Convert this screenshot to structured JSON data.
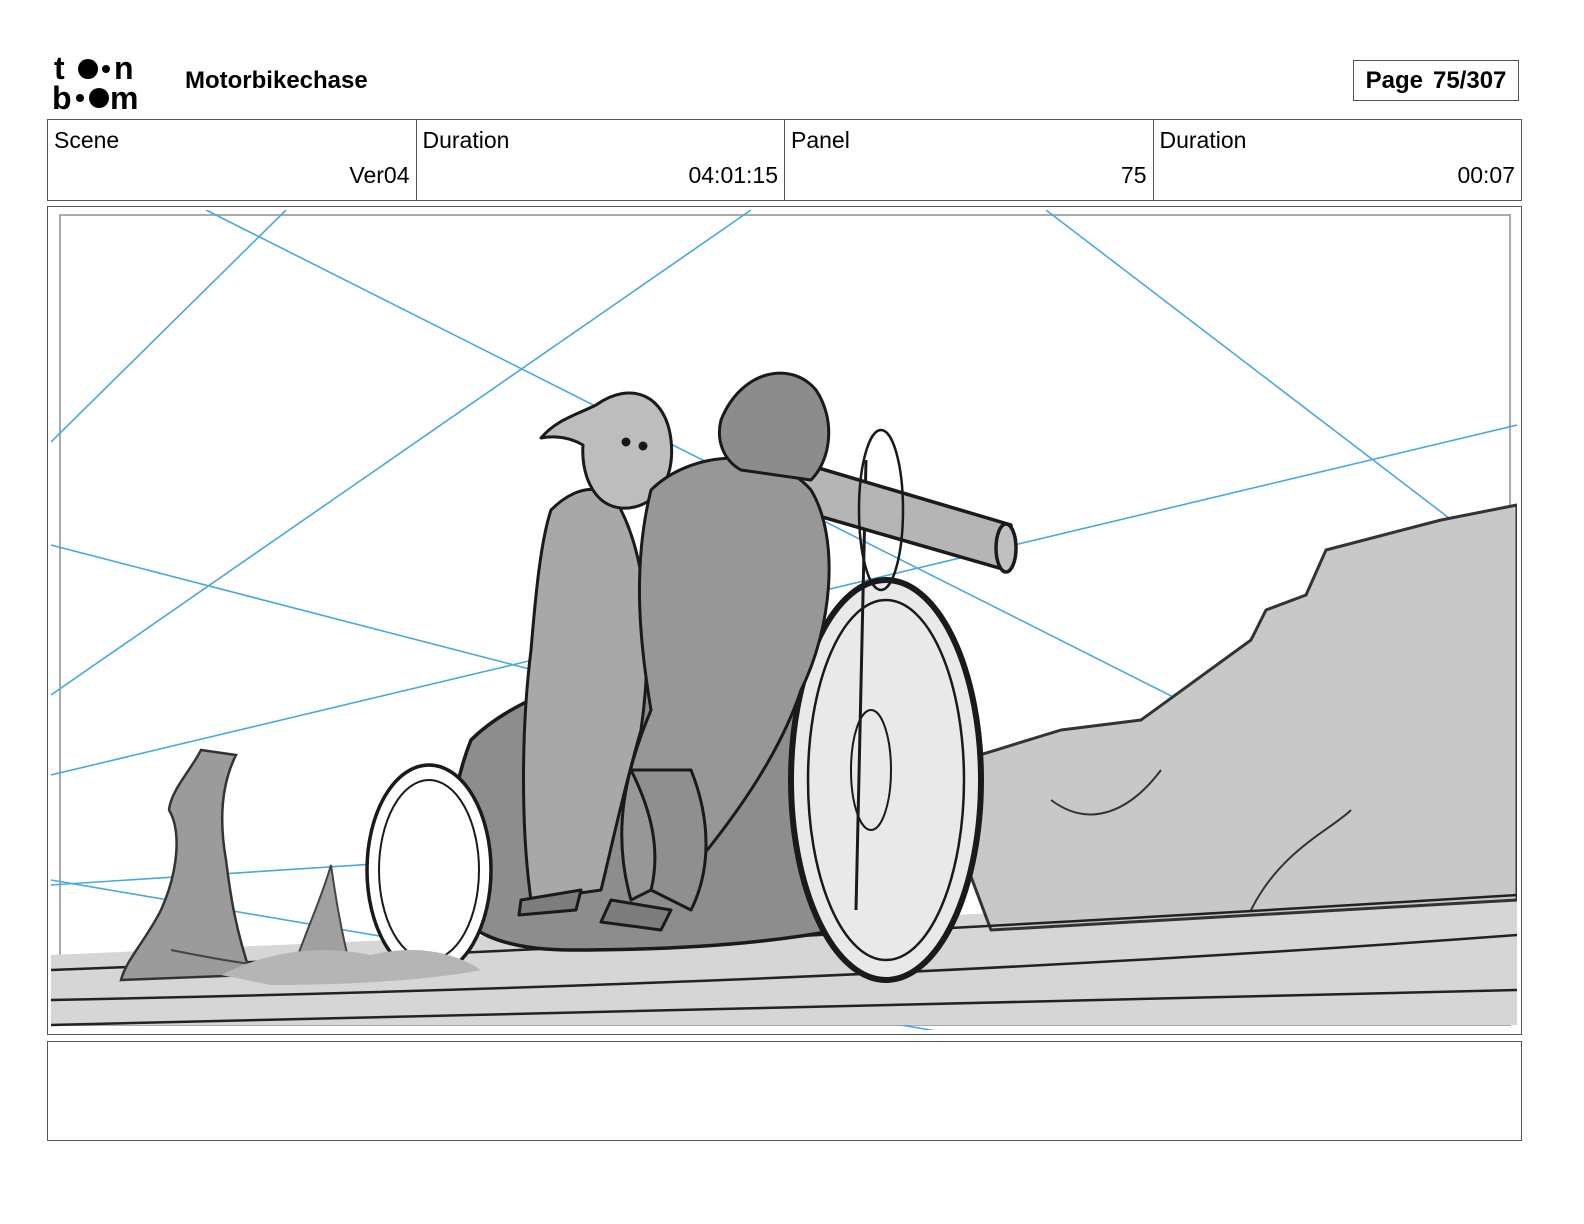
{
  "header": {
    "logo_text": "toonboom",
    "project_title": "Motorbikechase",
    "page_label": "Page",
    "page_value": "75/307"
  },
  "info": {
    "scene_label": "Scene",
    "scene_value": "Ver04",
    "scene_duration_label": "Duration",
    "scene_duration_value": "04:01:15",
    "panel_label": "Panel",
    "panel_value": "75",
    "panel_duration_label": "Duration",
    "panel_duration_value": "00:07"
  },
  "panel": {
    "image": "storyboard-sketch"
  },
  "colors": {
    "border": "#555555",
    "guide_lines": "#4aa8dc",
    "sketch_fill": "#c8c8c8",
    "sketch_shadow": "#8f8f8f"
  }
}
